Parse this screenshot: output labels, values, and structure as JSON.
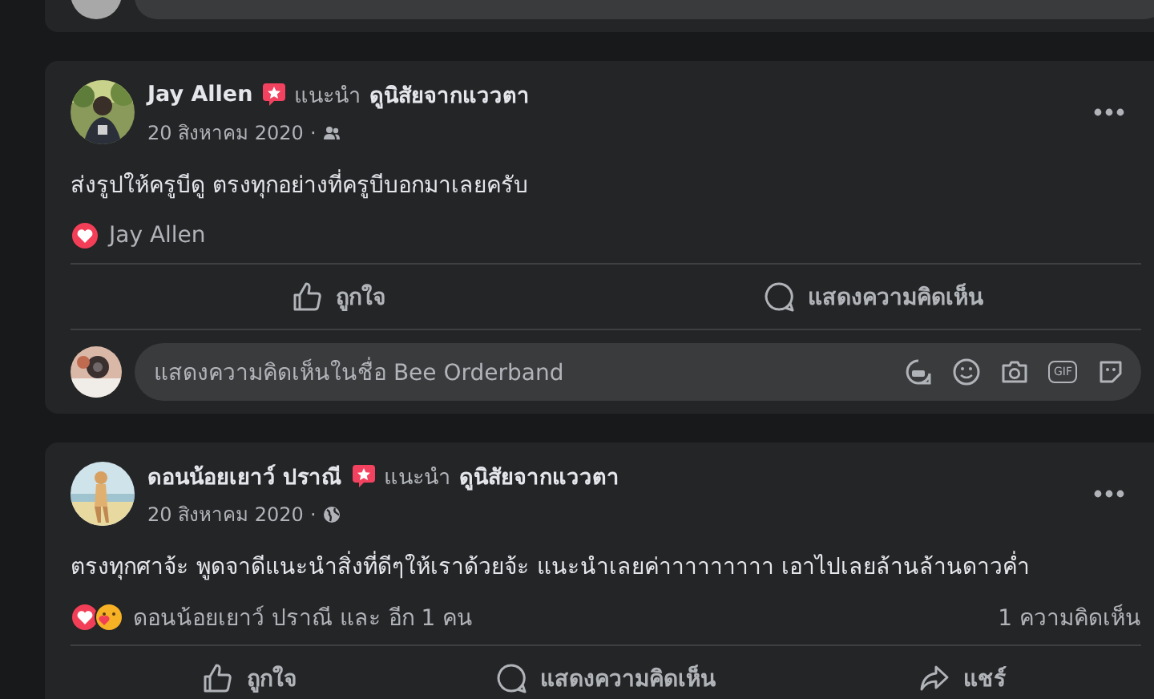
{
  "posts": [
    {
      "author": "Jay Allen",
      "badge": true,
      "recommends": "แนะนำ",
      "page": "ดูนิสัยจากแววตา",
      "date": "20 สิงหาคม 2020",
      "separator": "·",
      "audience": {
        "kind": "friends"
      },
      "text": "ส่งรูปให้ครูบีดู ตรงทุกอย่างที่ครูบีบอกมาเลยครับ",
      "reactions": [
        {
          "kind": "love"
        }
      ],
      "reaction_text": "Jay Allen",
      "actions": [
        {
          "kind": "like",
          "label": "ถูกใจ"
        },
        {
          "kind": "comment",
          "label": "แสดงความคิดเห็น"
        }
      ],
      "comment_box": {
        "placeholder": "แสดงความคิดเห็นในชื่อ Bee Orderband",
        "gif": "GIF"
      }
    },
    {
      "author": "ดอนน้อยเยาว์ ปราณี",
      "badge": true,
      "recommends": "แนะนำ",
      "page": "ดูนิสัยจากแววตา",
      "date": "20 สิงหาคม 2020",
      "separator": "·",
      "audience": {
        "kind": "public"
      },
      "text": "ตรงทุกศาจ้ะ พูดจาดีแนะนำสิ่งที่ดีๆให้เราด้วยจ้ะ แนะนำเลยค่าาาาาาาาา เอาไปเลยล้านล้านดาวค่ำ",
      "reactions": [
        {
          "kind": "love"
        },
        {
          "kind": "care"
        }
      ],
      "reaction_text": "ดอนน้อยเยาว์ ปราณี และ อีก 1 คน",
      "comment_count": "1 ความคิดเห็น",
      "actions": [
        {
          "kind": "like",
          "label": "ถูกใจ"
        },
        {
          "kind": "comment",
          "label": "แสดงความคิดเห็น"
        },
        {
          "kind": "share",
          "label": "แชร์"
        }
      ]
    }
  ]
}
